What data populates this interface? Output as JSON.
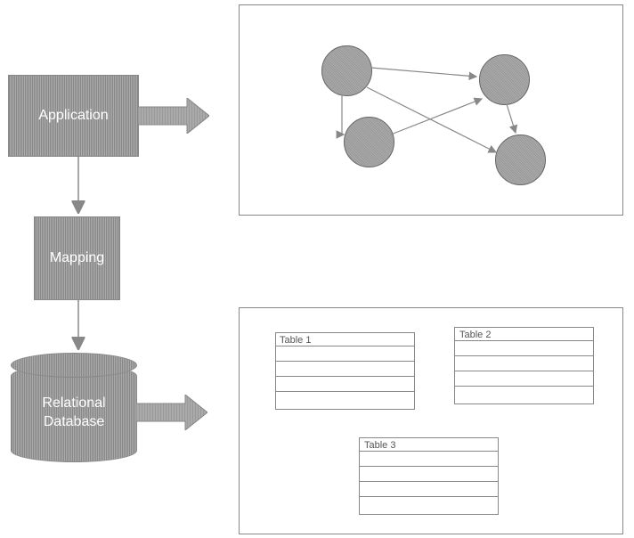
{
  "blocks": {
    "application": "Application",
    "mapping": "Mapping",
    "database": "Relational\nDatabase"
  },
  "tables": {
    "t1": "Table 1",
    "t2": "Table 2",
    "t3": "Table 3"
  }
}
